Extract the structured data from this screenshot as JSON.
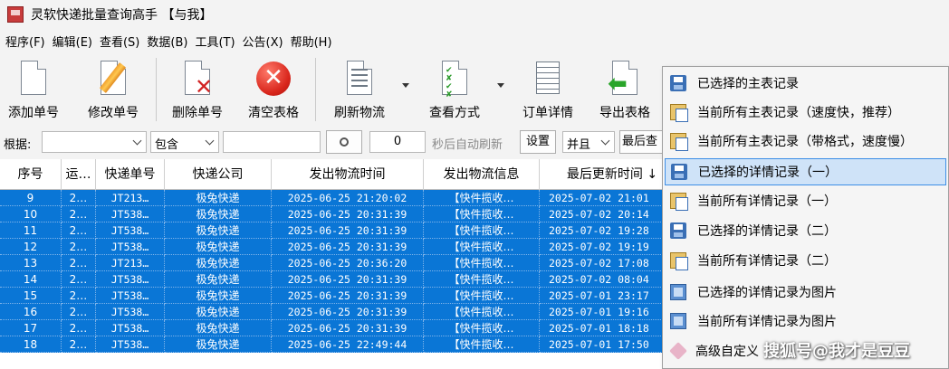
{
  "window": {
    "title": "灵软快递批量查询高手 【与我】"
  },
  "menubar": [
    "程序(F)",
    "编辑(E)",
    "查看(S)",
    "数据(B)",
    "工具(T)",
    "公告(X)",
    "帮助(H)"
  ],
  "toolbar": {
    "add": "添加单号",
    "edit": "修改单号",
    "delete": "删除单号",
    "clear": "清空表格",
    "refresh": "刷新物流",
    "view_mode": "查看方式",
    "order_detail": "订单详情",
    "export": "导出表格"
  },
  "filter": {
    "basis_label": "根据:",
    "basis_value": "",
    "match_mode": "包含",
    "keyword": "",
    "auto_refresh_seconds": "0",
    "auto_refresh_label": "秒后自动刷新",
    "settings_button": "设置",
    "logic": "并且",
    "last_query": "最后查"
  },
  "table": {
    "columns": [
      "序号",
      "运…",
      "快递单号",
      "快递公司",
      "发出物流时间",
      "发出物流信息",
      "最后更新时间"
    ],
    "sort_indicator": "↓",
    "rows": [
      {
        "seq": "9",
        "c2": "2…",
        "tracking": "JT213…",
        "company": "极兔快递",
        "sent_time": "2025-06-25 21:20:02",
        "info": "【快件揽收…",
        "updated": "2025-07-02 21:01"
      },
      {
        "seq": "10",
        "c2": "2…",
        "tracking": "JT538…",
        "company": "极兔快递",
        "sent_time": "2025-06-25 20:31:39",
        "info": "【快件揽收…",
        "updated": "2025-07-02 20:14"
      },
      {
        "seq": "11",
        "c2": "2…",
        "tracking": "JT538…",
        "company": "极兔快递",
        "sent_time": "2025-06-25 20:31:39",
        "info": "【快件揽收…",
        "updated": "2025-07-02 19:28"
      },
      {
        "seq": "12",
        "c2": "2…",
        "tracking": "JT538…",
        "company": "极兔快递",
        "sent_time": "2025-06-25 20:31:39",
        "info": "【快件揽收…",
        "updated": "2025-07-02 19:19"
      },
      {
        "seq": "13",
        "c2": "2…",
        "tracking": "JT213…",
        "company": "极兔快递",
        "sent_time": "2025-06-25 20:36:20",
        "info": "【快件揽收…",
        "updated": "2025-07-02 17:08"
      },
      {
        "seq": "14",
        "c2": "2…",
        "tracking": "JT538…",
        "company": "极兔快递",
        "sent_time": "2025-06-25 20:31:39",
        "info": "【快件揽收…",
        "updated": "2025-07-02 08:04"
      },
      {
        "seq": "15",
        "c2": "2…",
        "tracking": "JT538…",
        "company": "极兔快递",
        "sent_time": "2025-06-25 20:31:39",
        "info": "【快件揽收…",
        "updated": "2025-07-01 23:17"
      },
      {
        "seq": "16",
        "c2": "2…",
        "tracking": "JT538…",
        "company": "极兔快递",
        "sent_time": "2025-06-25 20:31:39",
        "info": "【快件揽收…",
        "updated": "2025-07-01 19:16"
      },
      {
        "seq": "17",
        "c2": "2…",
        "tracking": "JT538…",
        "company": "极兔快递",
        "sent_time": "2025-06-25 20:31:39",
        "info": "【快件揽收…",
        "updated": "2025-07-01 18:18"
      },
      {
        "seq": "18",
        "c2": "2…",
        "tracking": "JT538…",
        "company": "极兔快递",
        "sent_time": "2025-06-25 22:49:44",
        "info": "【快件揽收…",
        "updated": "2025-07-01 17:50"
      }
    ]
  },
  "context_menu": [
    {
      "icon": "save-icon",
      "label": "已选择的主表记录"
    },
    {
      "icon": "copy-icon",
      "label": "当前所有主表记录（速度快，推荐）"
    },
    {
      "icon": "copy-icon",
      "label": "当前所有主表记录（带格式，速度慢）"
    },
    {
      "icon": "save-icon",
      "label": "已选择的详情记录（一）",
      "highlighted": true
    },
    {
      "icon": "copy-icon",
      "label": "当前所有详情记录（一）"
    },
    {
      "icon": "save-icon",
      "label": "已选择的详情记录（二）"
    },
    {
      "icon": "copy-icon",
      "label": "当前所有详情记录（二）"
    },
    {
      "icon": "picture-icon",
      "label": "已选择的详情记录为图片"
    },
    {
      "icon": "picture-icon",
      "label": "当前所有详情记录为图片"
    },
    {
      "icon": "tag-icon",
      "label": "高级自定义"
    }
  ],
  "watermark": "搜狐号@我才是豆豆",
  "colors": {
    "selection": "#0a76d6",
    "menu_highlight": "#cfe3f8"
  }
}
